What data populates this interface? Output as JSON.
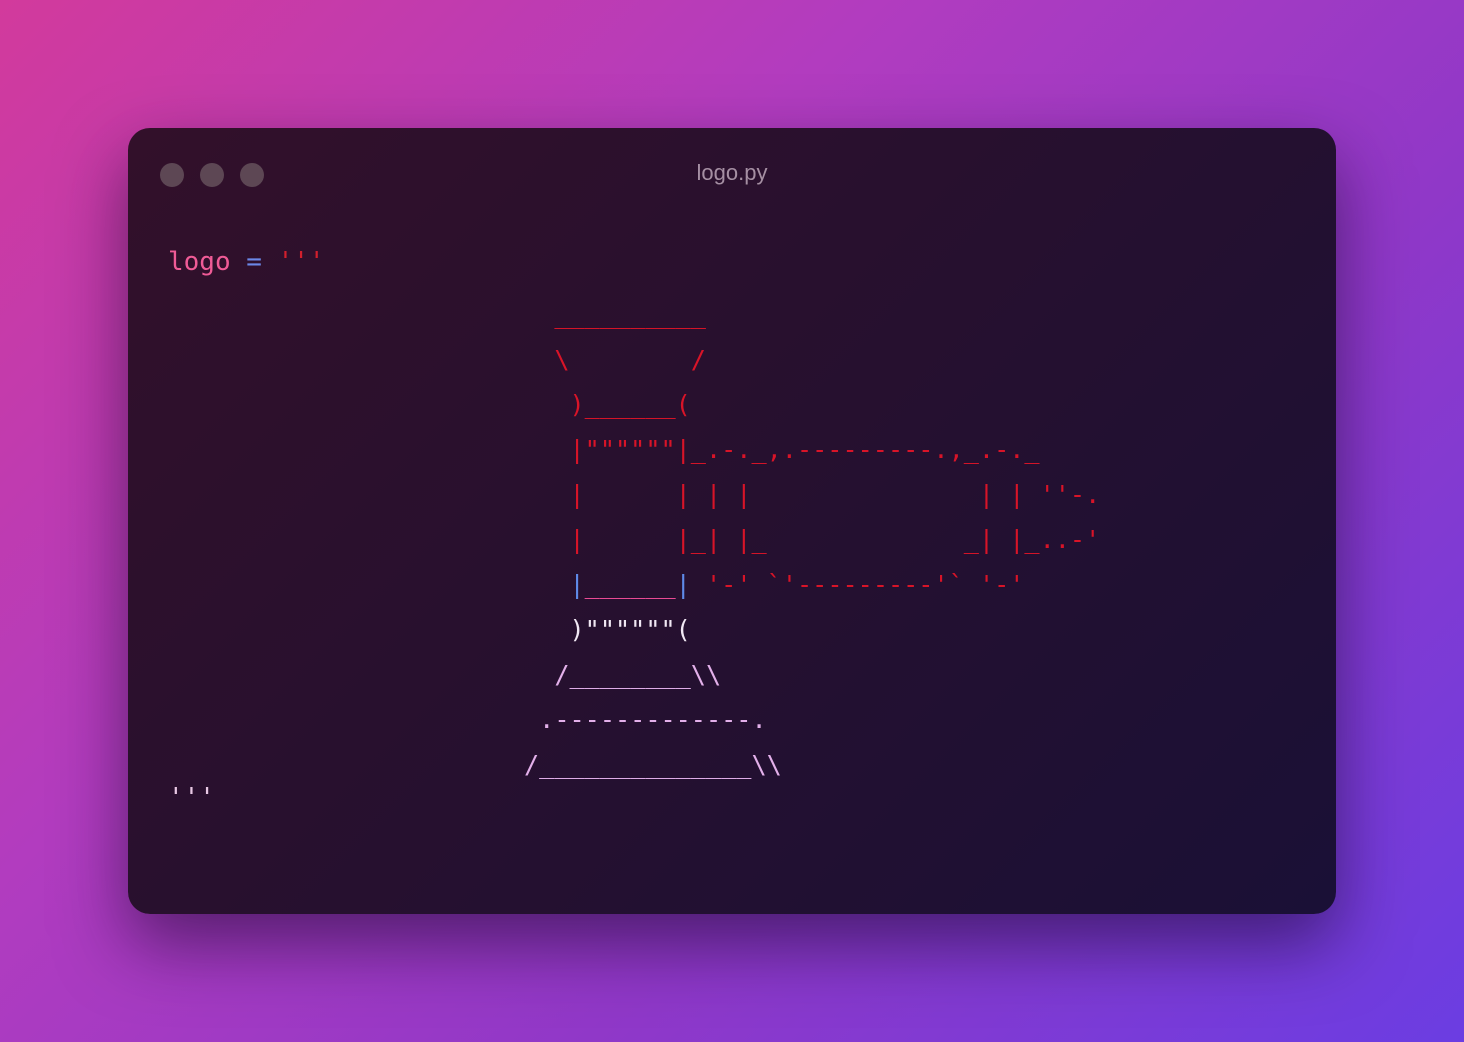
{
  "window": {
    "title": "logo.py"
  },
  "code": {
    "variable": "logo",
    "operator": "=",
    "open_quote": "'''",
    "close_quote": "'''"
  },
  "art": {
    "l1": "  __________",
    "l2": "  \\        /",
    "l3_a": "   )",
    "l3_b": "______",
    "l3_c": "(",
    "l4": "   |\"\"\"\"\"\"|_.-._,.---------.,_.-._",
    "l5": "   |      | | |               | | ''-.",
    "l6": "   |      |_| |_             _| |_..-'",
    "l7_a": "   |",
    "l7_b": "______",
    "l7_c": "|",
    "l7_d": " '-' `'---------'` '-'",
    "l8": "   )\"\"\"\"\"\"(",
    "l9": "  /________\\\\",
    ".l10": "",
    "l10": " .-------------.",
    "l11": "/______________\\\\"
  },
  "colors": {
    "accent_pink": "#ef5b96",
    "accent_blue": "#6b88e8",
    "string_red": "#d21f2d"
  }
}
